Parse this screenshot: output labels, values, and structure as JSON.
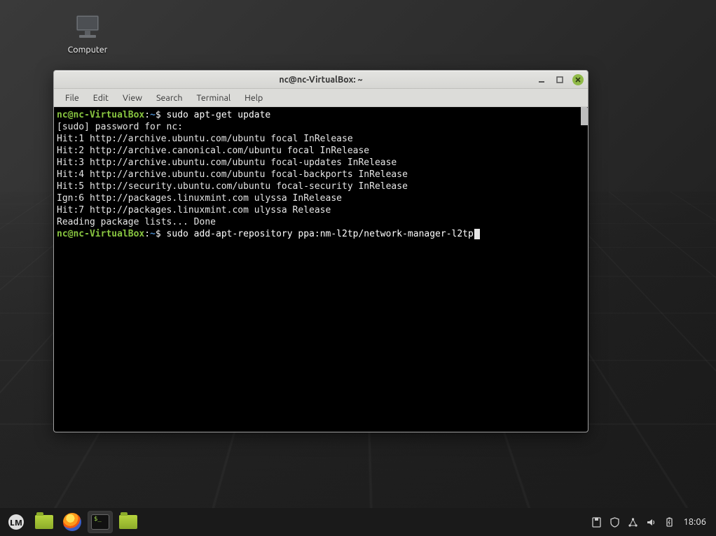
{
  "desktop": {
    "icons": [
      {
        "name": "computer",
        "label": "Computer"
      }
    ]
  },
  "window": {
    "title": "nc@nc-VirtualBox: ~",
    "menus": [
      "File",
      "Edit",
      "View",
      "Search",
      "Terminal",
      "Help"
    ]
  },
  "terminal": {
    "prompt_user": "nc@nc-VirtualBox",
    "prompt_path": "~",
    "cmd1": "sudo apt-get update",
    "lines": [
      "[sudo] password for nc:",
      "Hit:1 http://archive.ubuntu.com/ubuntu focal InRelease",
      "Hit:2 http://archive.canonical.com/ubuntu focal InRelease",
      "Hit:3 http://archive.ubuntu.com/ubuntu focal-updates InRelease",
      "Hit:4 http://archive.ubuntu.com/ubuntu focal-backports InRelease",
      "Hit:5 http://security.ubuntu.com/ubuntu focal-security InRelease",
      "Ign:6 http://packages.linuxmint.com ulyssa InRelease",
      "Hit:7 http://packages.linuxmint.com ulyssa Release",
      "Reading package lists... Done"
    ],
    "cmd2": "sudo add-apt-repository ppa:nm-l2tp/network-manager-l2tp"
  },
  "panel": {
    "clock": "18:06",
    "launchers": [
      "menu",
      "files",
      "firefox",
      "terminal",
      "files2"
    ],
    "tray": [
      "removable-media",
      "shield",
      "network",
      "volume",
      "power"
    ]
  }
}
